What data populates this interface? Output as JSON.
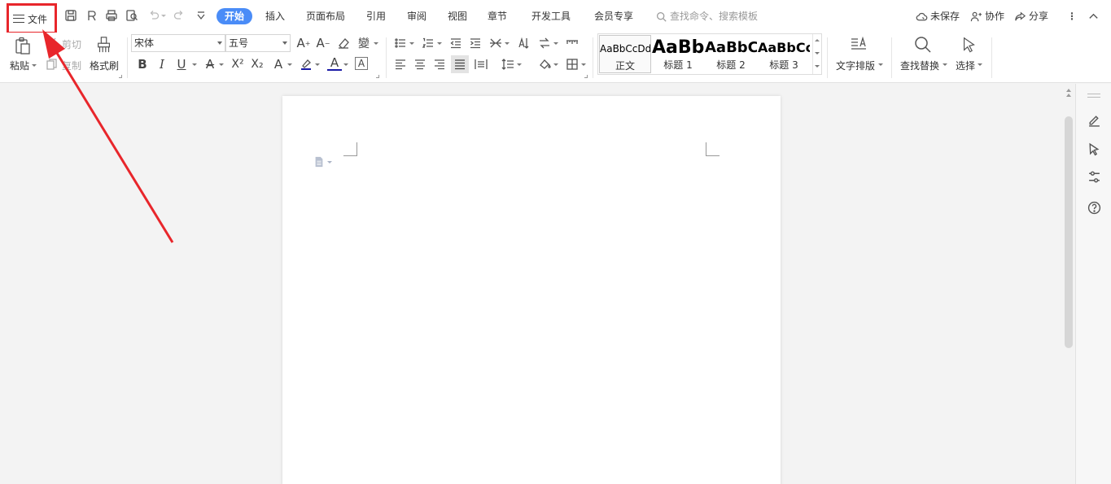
{
  "file_menu": {
    "label": "文件",
    "icon": "hamburger-menu-icon"
  },
  "tabs": [
    "开始",
    "插入",
    "页面布局",
    "引用",
    "审阅",
    "视图",
    "章节",
    "开发工具",
    "会员专享"
  ],
  "active_tab": "开始",
  "search": {
    "placeholder": "查找命令、搜索模板"
  },
  "right_actions": {
    "unsaved": "未保存",
    "collab": "协作",
    "share": "分享"
  },
  "ribbon": {
    "paste_label": "粘贴",
    "cut_label": "剪切",
    "copy_label": "复制",
    "format_painter_label": "格式刷",
    "font_name": "宋体",
    "font_size": "五号",
    "styles": [
      {
        "preview": "AaBbCcDd",
        "name": "正文"
      },
      {
        "preview": "AaBb",
        "name": "标题 1"
      },
      {
        "preview": "AaBbC",
        "name": "标题 2"
      },
      {
        "preview": "AaBbCc",
        "name": "标题 3"
      }
    ],
    "text_layout_label": "文字排版",
    "find_replace_label": "查找替换",
    "select_label": "选择"
  },
  "colors": {
    "accent": "#4a8cf7",
    "annotation": "#e8262b",
    "highlight": "#1a1aa6",
    "font_color": "#1a1aa6"
  }
}
